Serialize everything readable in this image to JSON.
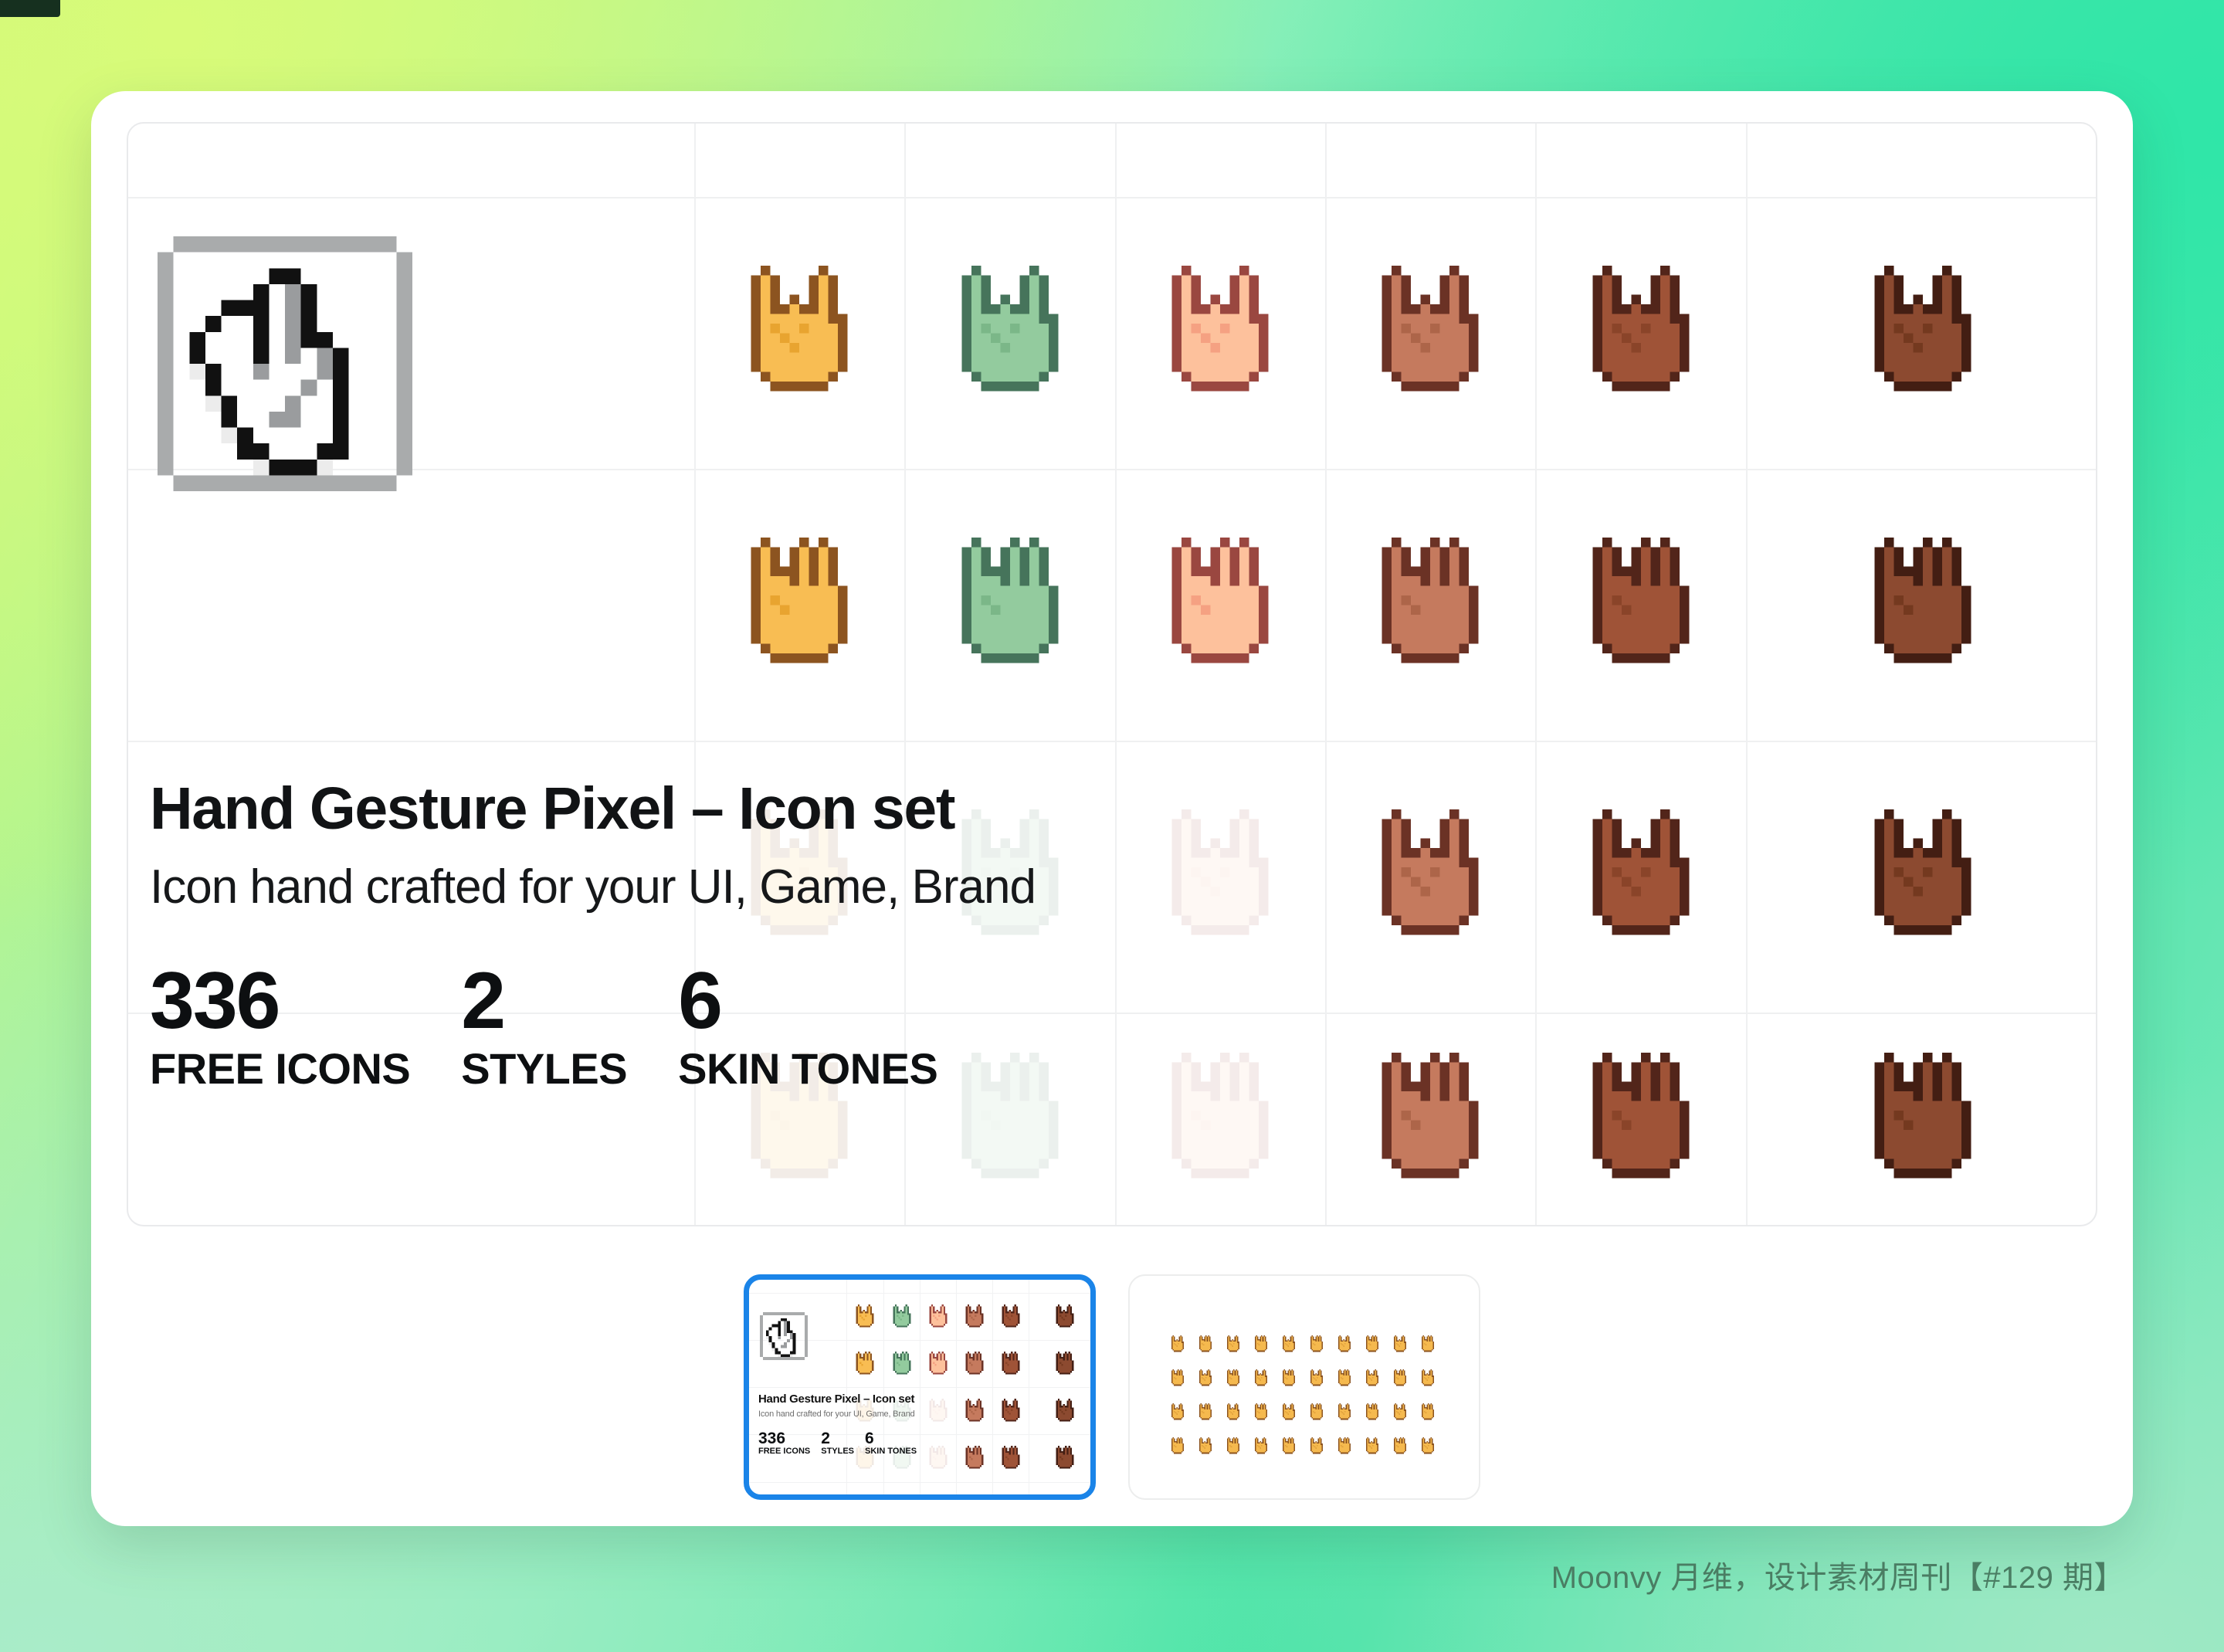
{
  "background": {
    "gradient_from": "#ccf879",
    "gradient_mid": "#45e3a6",
    "gradient_to": "#9fe8c4"
  },
  "card": {
    "hero_icon": "pixel-hand-pointing-cursor-icon",
    "title": "Hand Gesture Pixel – Icon set",
    "subtitle": "Icon hand crafted for your UI, Game, Brand",
    "stats": [
      {
        "number": "336",
        "label": "FREE ICONS"
      },
      {
        "number": "2",
        "label": "STYLES"
      },
      {
        "number": "6",
        "label": "SKIN TONES"
      }
    ]
  },
  "icon_grid": {
    "columns": 7,
    "rows": 4,
    "skin_tone_names": [
      "outline",
      "orange",
      "green",
      "light",
      "medium",
      "dark",
      "darkest"
    ],
    "palettes": {
      "outline": {
        "fill": "#ffffff",
        "shade": "#f0f0f0",
        "line": "#111111"
      },
      "orange": {
        "fill": "#f8bd53",
        "shade": "#e8a430",
        "line": "#8c5420"
      },
      "green": {
        "fill": "#93cb9e",
        "shade": "#7bb788",
        "line": "#46745b"
      },
      "light": {
        "fill": "#fdc19c",
        "shade": "#f5a182",
        "line": "#9a4740"
      },
      "medium": {
        "fill": "#c57a5e",
        "shade": "#ad6549",
        "line": "#6b3225"
      },
      "dark": {
        "fill": "#9f5337",
        "shade": "#8a4429",
        "line": "#52251a"
      },
      "darkest": {
        "fill": "#8c4a30",
        "shade": "#74391f",
        "line": "#431e13"
      }
    },
    "row_gestures": [
      "horns-rock-hand",
      "spock-hand",
      "horns-rock-hand",
      "spock-hand"
    ],
    "faded_cells_note": "Rows 3 and 4 columns 1-3 are faded behind the title text"
  },
  "thumbnails": [
    {
      "name": "cover-preview",
      "selected": true,
      "accent": "#1a84e8",
      "title": "Hand Gesture Pixel – Icon set",
      "subtitle": "Icon hand crafted for your UI, Game, Brand",
      "stats": [
        {
          "number": "336",
          "label": "FREE ICONS"
        },
        {
          "number": "2",
          "label": "STYLES"
        },
        {
          "number": "6",
          "label": "SKIN TONES"
        }
      ]
    },
    {
      "name": "icon-sheet-preview",
      "selected": false,
      "grid_columns": 10,
      "grid_rows": 4,
      "icon_color": "#f5b94e"
    }
  ],
  "watermark": "Moonvy 月维，设计素材周刊【#129 期】"
}
